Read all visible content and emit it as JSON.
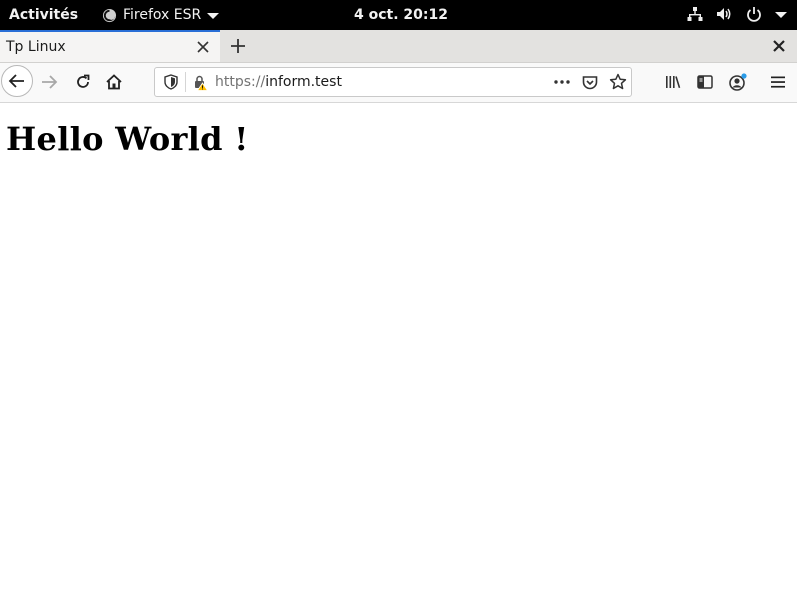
{
  "system_bar": {
    "activities_label": "Activités",
    "app_name": "Firefox ESR",
    "clock": "4 oct.  20:12",
    "icons": [
      "network-icon",
      "volume-icon",
      "power-icon",
      "system-menu-arrow-icon"
    ]
  },
  "tabs": [
    {
      "title": "Tp Linux",
      "active": true
    }
  ],
  "toolbar": {
    "url_protocol": "https://",
    "url_host": "inform.test",
    "icons": [
      "back-icon",
      "forward-icon",
      "reload-icon",
      "home-icon",
      "tracking-shield-icon",
      "insecure-lock-icon",
      "page-actions-icon",
      "pocket-icon",
      "bookmark-star-icon",
      "library-icon",
      "sidebar-icon",
      "account-icon",
      "hamburger-menu-icon"
    ],
    "accent_color": "#2a6fd6",
    "warning_color": "#ffbf00"
  },
  "page": {
    "heading": "Hello World !"
  }
}
